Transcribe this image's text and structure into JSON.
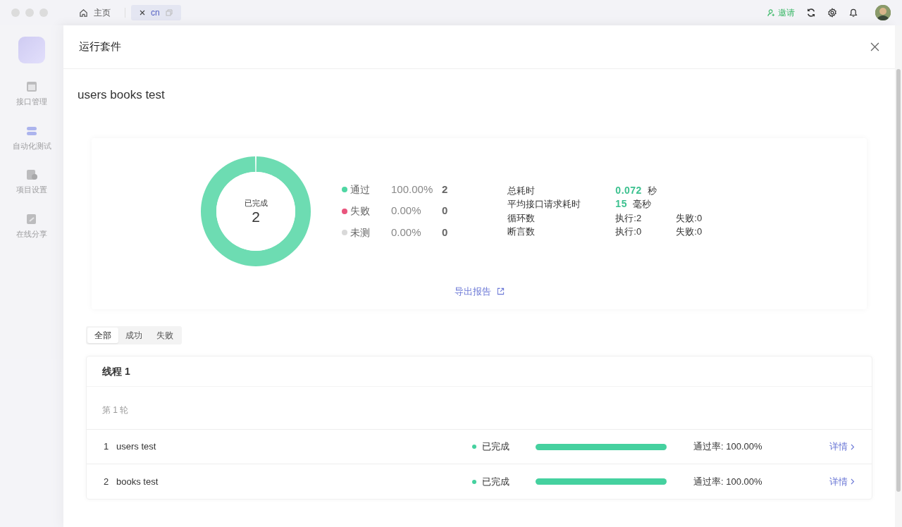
{
  "titlebar": {
    "tabs": [
      {
        "label": "主页",
        "kind": "home",
        "selected": false
      },
      {
        "label": "cn",
        "kind": "closable",
        "selected": true
      }
    ],
    "invite": "邀请"
  },
  "sidebar": {
    "items": [
      {
        "label": "接口管理",
        "kind": "api"
      },
      {
        "label": "自动化测试",
        "kind": "auto"
      },
      {
        "label": "项目设置",
        "kind": "settings"
      },
      {
        "label": "在线分享",
        "kind": "share"
      }
    ]
  },
  "drawer": {
    "title": "运行套件",
    "suite_name": "users books test",
    "summary": {
      "center_label": "已完成",
      "center_value": "2",
      "chart_data": {
        "type": "donut",
        "categories": [
          "通过",
          "失败",
          "未测"
        ],
        "values": [
          100,
          0,
          0
        ]
      },
      "legend": [
        {
          "percent": "100.00%",
          "count": "2",
          "color": "#4fd6a3"
        },
        {
          "percent": "0.00%",
          "count": "0",
          "color": "#e9557d"
        },
        {
          "percent": "0.00%",
          "count": "0",
          "color": "#d9d9d9"
        }
      ],
      "stats": [
        {
          "kind": "timing",
          "label": "总耗时",
          "value": "0.072",
          "unit": "秒"
        },
        {
          "kind": "timing",
          "label": "平均接口请求耗时",
          "value": "15",
          "unit": "毫秒"
        },
        {
          "kind": "count",
          "label": "循环数",
          "executed": "执行:2",
          "failed": "失败:0"
        },
        {
          "kind": "count",
          "label": "断言数",
          "executed": "执行:0",
          "failed": "失败:0"
        }
      ],
      "export_link": "导出报告"
    },
    "filter_tabs": [
      {
        "label": "全部",
        "selected": true
      },
      {
        "label": "成功",
        "selected": false
      },
      {
        "label": "失败",
        "selected": false
      }
    ],
    "thread": {
      "title": "线程 1",
      "round": "第 1 轮",
      "rows": [
        {
          "index": "1",
          "name": "users test",
          "status": "已完成",
          "level": 1,
          "pass_rate": "通过率: 100.00%",
          "details": "详情"
        },
        {
          "index": "2",
          "name": "books test",
          "status": "已完成",
          "level": 1,
          "pass_rate": "通过率: 100.00%",
          "details": "详情"
        }
      ]
    }
  }
}
